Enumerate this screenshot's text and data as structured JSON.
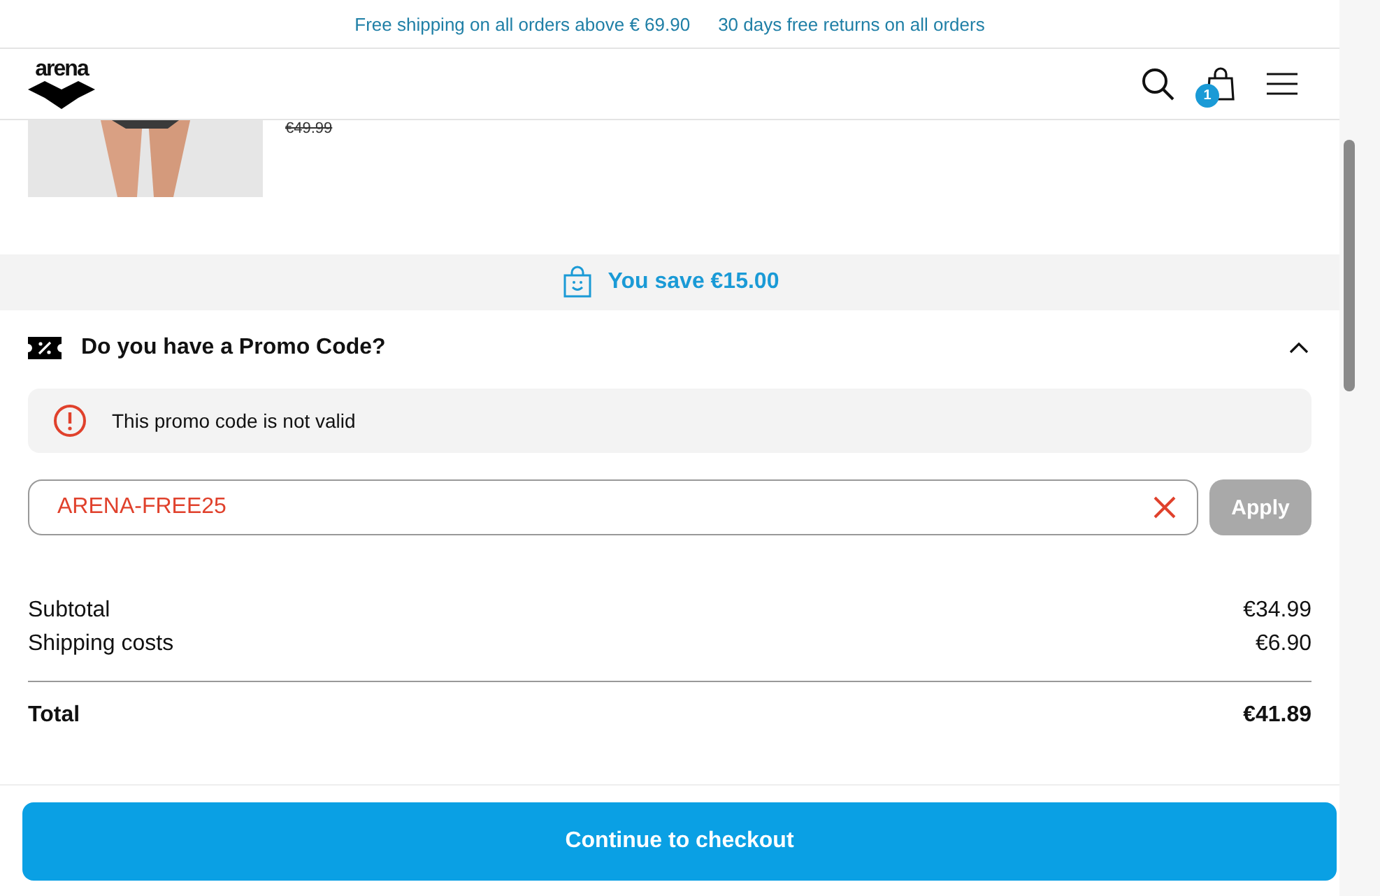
{
  "announcement_bar": {
    "messages": [
      "Free shipping on all orders above € 69.90",
      "30 days free returns on all orders"
    ]
  },
  "header": {
    "logo": "arena",
    "cart_count": "1"
  },
  "product": {
    "original_price": "€49.99"
  },
  "savings_banner": {
    "text": "You save €15.00"
  },
  "promo_code": {
    "title": "Do you have a Promo Code?",
    "expanded": true,
    "error": "This promo code is not valid",
    "value": "ARENA-FREE25",
    "apply_button": {
      "label": "Apply",
      "disabled": true
    }
  },
  "summary": {
    "rows": [
      {
        "label": "Subtotal",
        "value": "€34.99"
      },
      {
        "label": "Shipping costs",
        "value": "€6.90"
      }
    ],
    "total": {
      "label": "Total",
      "value": "€41.89"
    }
  },
  "checkout_button": {
    "label": "Continue to checkout"
  }
}
